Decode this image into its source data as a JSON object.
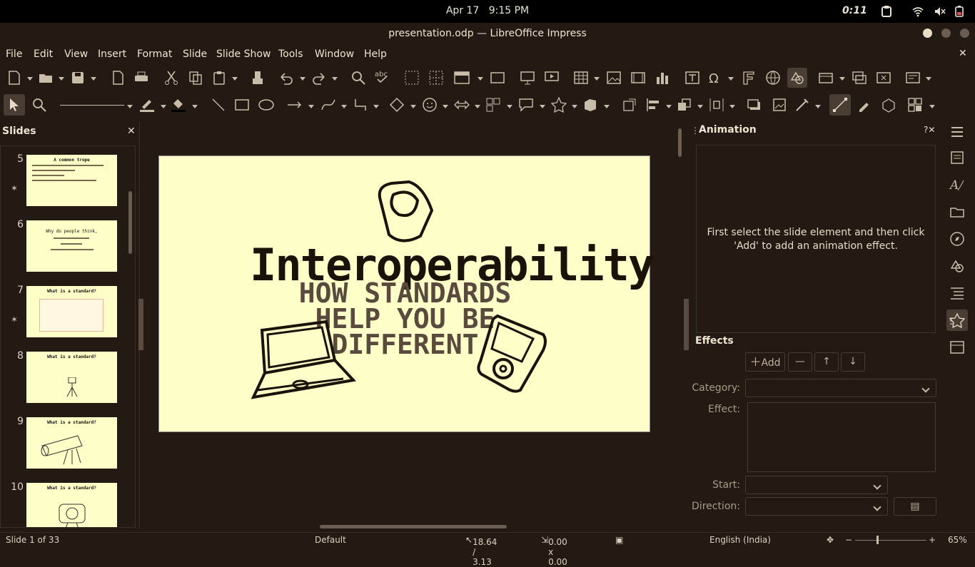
{
  "topbar": {
    "date": "Apr 17",
    "time": "9:15 PM",
    "timer": "0:11"
  },
  "window": {
    "title": "presentation.odp — LibreOffice Impress"
  },
  "menu": [
    "File",
    "Edit",
    "View",
    "Insert",
    "Format",
    "Slide",
    "Slide Show",
    "Tools",
    "Window",
    "Help"
  ],
  "slides_pane": {
    "title": "Slides"
  },
  "thumbs": [
    {
      "n": "5",
      "title": "A common trope"
    },
    {
      "n": "6",
      "title": "Why do people think,"
    },
    {
      "n": "7",
      "title": "What is a standard?"
    },
    {
      "n": "8",
      "title": "What is a standard?"
    },
    {
      "n": "9",
      "title": "What is a standard?"
    },
    {
      "n": "10",
      "title": "What is a standard?"
    }
  ],
  "slide": {
    "title": "Interoperability",
    "subtitle_l1": "HOW STANDARDS",
    "subtitle_l2": "HELP YOU BE",
    "subtitle_l3": "DIFFERENT"
  },
  "animation": {
    "title": "Animation",
    "help": "?",
    "message": "First select the slide element and then click 'Add' to add an animation effect.",
    "effects": "Effects",
    "add": "Add",
    "category": "Category:",
    "effect": "Effect:",
    "start": "Start:",
    "direction": "Direction:"
  },
  "status": {
    "slide": "Slide 1 of 33",
    "layout": "Default",
    "pos": "18.64 / 3.13",
    "size": "0.00 x 0.00",
    "lang": "English (India)",
    "zoom": "65%"
  },
  "colors": {
    "bg": "#241a14",
    "slide_bg": "#fefec8",
    "accent": "#4a3d33"
  }
}
